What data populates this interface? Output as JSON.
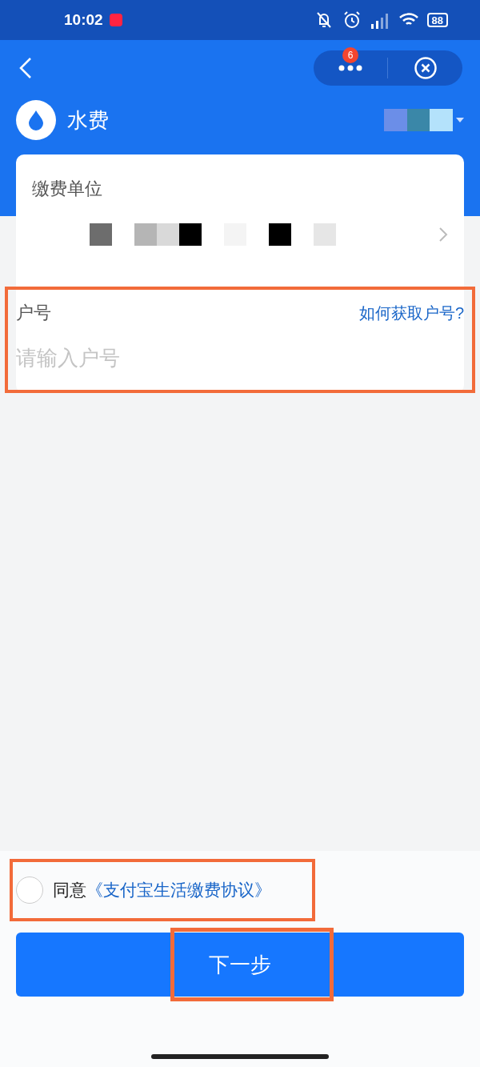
{
  "status_bar": {
    "time": "10:02",
    "battery": "88"
  },
  "nav": {
    "badge": "6"
  },
  "header": {
    "title": "水费"
  },
  "form": {
    "unit_label": "缴费单位",
    "account": {
      "label": "户号",
      "help_link": "如何获取户号?",
      "placeholder": "请输入户号"
    }
  },
  "agreement": {
    "checked": false,
    "prefix": "同意",
    "link": "《支付宝生活缴费协议》"
  },
  "next_button": "下一步"
}
